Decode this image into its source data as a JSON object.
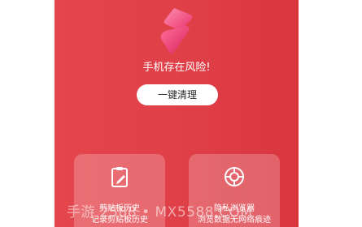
{
  "status": {
    "message": "手机存在风险!"
  },
  "actions": {
    "clean_label": "一键清理"
  },
  "cards": [
    {
      "title": "剪贴板历史",
      "subtitle": "记录剪贴板历史",
      "icon": "clipboard-pencil-icon"
    },
    {
      "title": "隐私浏览器",
      "subtitle": "浏览数据无网络痕迹",
      "icon": "browser-globe-icon"
    }
  ],
  "watermark": {
    "text": "手游 2588 • MX5588.COM"
  },
  "colors": {
    "background_start": "#e5464d",
    "background_end": "#d9363f",
    "logo_start": "#ff7aa0",
    "logo_end": "#e8306a"
  }
}
